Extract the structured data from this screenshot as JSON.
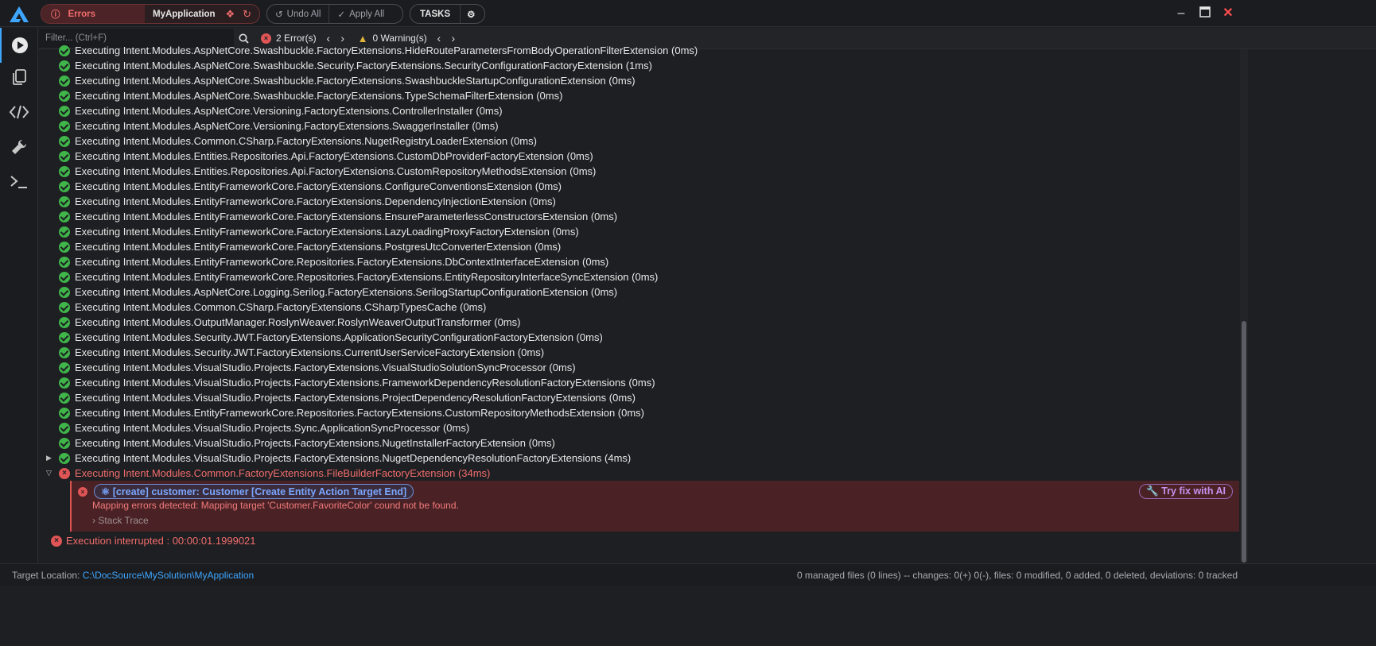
{
  "titlebar": {
    "errors_label": "Errors",
    "app_name": "MyApplication",
    "undo_label": "Undo All",
    "apply_label": "Apply All",
    "tasks_label": "TASKS",
    "minimize_icon": "minimize-icon",
    "maximize_icon": "maximize-icon",
    "close_icon": "close-icon"
  },
  "sidebar": {
    "items": [
      "run-icon",
      "copy-icon",
      "code-icon",
      "wrench-icon",
      "terminal-icon"
    ]
  },
  "filter": {
    "placeholder": "Filter... (Ctrl+F)",
    "errors_count": "2 Error(s)",
    "warnings_count": "0 Warning(s)"
  },
  "log": {
    "rows": [
      "Executing Intent.Modules.AspNetCore.Swashbuckle.FactoryExtensions.HideRouteParametersFromBodyOperationFilterExtension (0ms)",
      "Executing Intent.Modules.AspNetCore.Swashbuckle.Security.FactoryExtensions.SecurityConfigurationFactoryExtension (1ms)",
      "Executing Intent.Modules.AspNetCore.Swashbuckle.FactoryExtensions.SwashbuckleStartupConfigurationExtension (0ms)",
      "Executing Intent.Modules.AspNetCore.Swashbuckle.FactoryExtensions.TypeSchemaFilterExtension (0ms)",
      "Executing Intent.Modules.AspNetCore.Versioning.FactoryExtensions.ControllerInstaller (0ms)",
      "Executing Intent.Modules.AspNetCore.Versioning.FactoryExtensions.SwaggerInstaller (0ms)",
      "Executing Intent.Modules.Common.CSharp.FactoryExtensions.NugetRegistryLoaderExtension (0ms)",
      "Executing Intent.Modules.Entities.Repositories.Api.FactoryExtensions.CustomDbProviderFactoryExtension (0ms)",
      "Executing Intent.Modules.Entities.Repositories.Api.FactoryExtensions.CustomRepositoryMethodsExtension (0ms)",
      "Executing Intent.Modules.EntityFrameworkCore.FactoryExtensions.ConfigureConventionsExtension (0ms)",
      "Executing Intent.Modules.EntityFrameworkCore.FactoryExtensions.DependencyInjectionExtension (0ms)",
      "Executing Intent.Modules.EntityFrameworkCore.FactoryExtensions.EnsureParameterlessConstructorsExtension (0ms)",
      "Executing Intent.Modules.EntityFrameworkCore.FactoryExtensions.LazyLoadingProxyFactoryExtension (0ms)",
      "Executing Intent.Modules.EntityFrameworkCore.FactoryExtensions.PostgresUtcConverterExtension (0ms)",
      "Executing Intent.Modules.EntityFrameworkCore.Repositories.FactoryExtensions.DbContextInterfaceExtension (0ms)",
      "Executing Intent.Modules.EntityFrameworkCore.Repositories.FactoryExtensions.EntityRepositoryInterfaceSyncExtension (0ms)",
      "Executing Intent.Modules.AspNetCore.Logging.Serilog.FactoryExtensions.SerilogStartupConfigurationExtension (0ms)",
      "Executing Intent.Modules.Common.CSharp.FactoryExtensions.CSharpTypesCache (0ms)",
      "Executing Intent.Modules.OutputManager.RoslynWeaver.RoslynWeaverOutputTransformer (0ms)",
      "Executing Intent.Modules.Security.JWT.FactoryExtensions.ApplicationSecurityConfigurationFactoryExtension (0ms)",
      "Executing Intent.Modules.Security.JWT.FactoryExtensions.CurrentUserServiceFactoryExtension (0ms)",
      "Executing Intent.Modules.VisualStudio.Projects.FactoryExtensions.VisualStudioSolutionSyncProcessor (0ms)",
      "Executing Intent.Modules.VisualStudio.Projects.FactoryExtensions.FrameworkDependencyResolutionFactoryExtensions (0ms)",
      "Executing Intent.Modules.VisualStudio.Projects.FactoryExtensions.ProjectDependencyResolutionFactoryExtensions (0ms)",
      "Executing Intent.Modules.EntityFrameworkCore.Repositories.FactoryExtensions.CustomRepositoryMethodsExtension (0ms)",
      "Executing Intent.Modules.VisualStudio.Projects.Sync.ApplicationSyncProcessor (0ms)",
      "Executing Intent.Modules.VisualStudio.Projects.FactoryExtensions.NugetInstallerFactoryExtension (0ms)",
      "Executing Intent.Modules.VisualStudio.Projects.FactoryExtensions.NugetDependencyResolutionFactoryExtensions (4ms)"
    ],
    "error_row": "Executing Intent.Modules.Common.FactoryExtensions.FileBuilderFactoryExtension (34ms)",
    "error_detail": {
      "tag": "[create] customer: Customer [Create Entity Action Target End]",
      "message": "Mapping errors detected: Mapping target 'Customer.FavoriteColor' cound not be found.",
      "stack_trace": "Stack Trace",
      "try_fix": "Try fix with AI"
    },
    "interrupted": "Execution interrupted : 00:00:01.1999021"
  },
  "status": {
    "target_label": "Target Location:",
    "target_path": "C:\\DocSource\\MySolution\\MyApplication",
    "summary": "0 managed files (0 lines) -- changes: 0(+) 0(-), files: 0 modified, 0 added, 0 deleted, deviations: 0 tracked"
  }
}
